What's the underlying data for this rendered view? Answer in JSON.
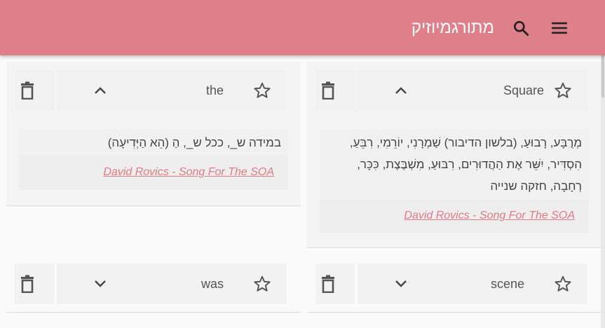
{
  "colors": {
    "appbar": "#df7f89",
    "accent_link": "#e07a85"
  },
  "appbar": {
    "title": "מתורגמיוזיק",
    "menu_icon": "hamburger-menu-icon",
    "search_icon": "search-icon"
  },
  "cards": [
    {
      "word": "Square",
      "expanded": true,
      "translation": "מְרֻבָּע, רָבוּעַ, (בלשון הדיבור) שַׁמְרָנִי, יוֹרֵמִי, רִבֵּעַ, הִסְדִּיר, יִשֵּׁר אֶת הַהֲדוּרִים, רִבּוּעַ, מִשְׁבֶּצֶת, כִּכָּר, רְחָבָה, חזקה שנייה",
      "source": "David Rovics - Song For The SOA"
    },
    {
      "word": "the",
      "expanded": true,
      "translation": "במידה ש_, ככל ש_, הַ (הֵא הַיְּדִיעָה)",
      "source": "David Rovics - Song For The SOA"
    },
    {
      "word": "scene",
      "expanded": false
    },
    {
      "word": "was",
      "expanded": false
    }
  ]
}
